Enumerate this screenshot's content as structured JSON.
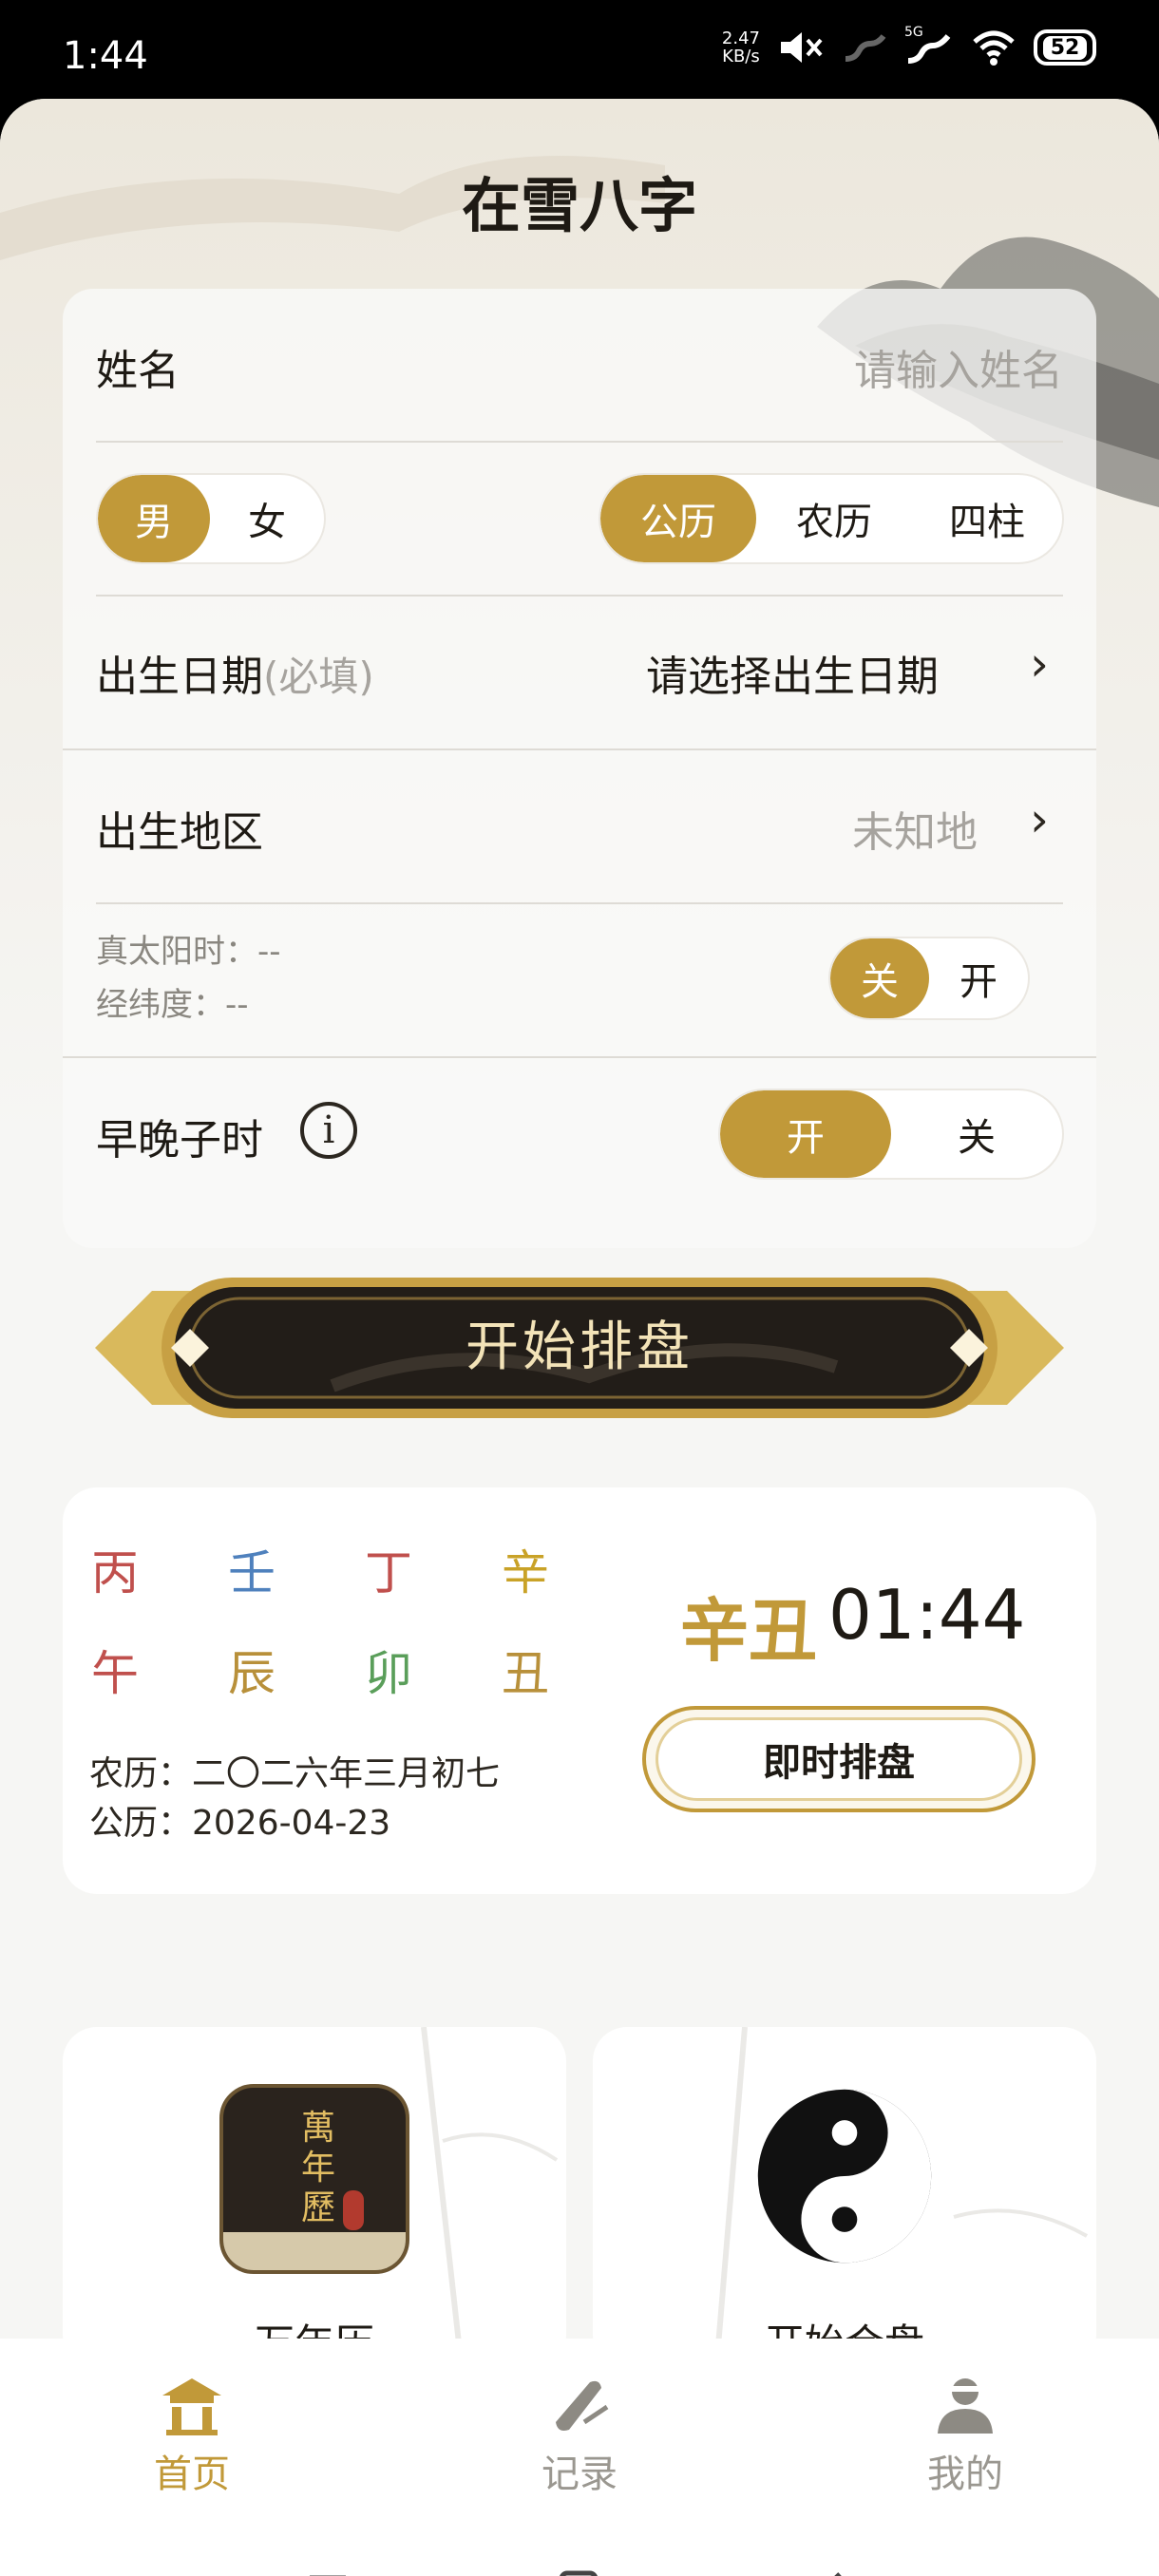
{
  "status_bar": {
    "time": "1:44",
    "net_speed_value": "2.47",
    "net_speed_unit": "KB/s",
    "network": "5G",
    "battery": "52",
    "icons": [
      "mute-icon",
      "signal-icon",
      "signal-5g-icon",
      "wifi-icon",
      "battery-icon"
    ]
  },
  "app_title": "在雪八字",
  "form": {
    "name_label": "姓名",
    "name_placeholder": "请输入姓名",
    "gender_options": [
      "男",
      "女"
    ],
    "gender_selected": "男",
    "calendar_options": [
      "公历",
      "农历",
      "四柱"
    ],
    "calendar_selected": "公历",
    "birth_date_label": "出生日期",
    "birth_date_required": "(必填)",
    "birth_date_value": "请选择出生日期",
    "birth_place_label": "出生地区",
    "birth_place_value": "未知地",
    "true_solar_time": "真太阳时：--",
    "longitude_latitude": "经纬度：--",
    "solar_toggle_options": [
      "关",
      "开"
    ],
    "solar_toggle_selected": "关",
    "zi_hour_label": "早晚子时",
    "zi_hour_options": [
      "开",
      "关"
    ],
    "zi_hour_selected": "开"
  },
  "start_button": "开始排盘",
  "current_bazi": {
    "stems": [
      "丙",
      "壬",
      "丁",
      "辛"
    ],
    "branches": [
      "午",
      "辰",
      "卯",
      "丑"
    ],
    "stem_colors": [
      "#c0504d",
      "#4f81bd",
      "#c0504d",
      "#c9a227"
    ],
    "branch_colors": [
      "#c0504d",
      "#b8903a",
      "#5a9e5a",
      "#b8903a"
    ],
    "lunar_date": "农历：二〇二六年三月初七",
    "solar_date": "公历：2026-04-23",
    "current_ganzhi": "辛丑",
    "current_time": "01:44",
    "instant_button": "即时排盘"
  },
  "tools": [
    {
      "label": "万年历",
      "icon": "perpetual-calendar-icon",
      "icon_text": [
        "萬",
        "年",
        "歷"
      ]
    },
    {
      "label": "开始合盘",
      "icon": "yin-yang-icon"
    }
  ],
  "bottom_nav": [
    {
      "label": "首页",
      "icon": "temple-home-icon",
      "active": true
    },
    {
      "label": "记录",
      "icon": "scroll-record-icon",
      "active": false
    },
    {
      "label": "我的",
      "icon": "monk-profile-icon",
      "active": false
    }
  ],
  "system_nav": [
    "menu-icon",
    "home-square-icon",
    "back-icon"
  ],
  "accent_color": "#c19939"
}
